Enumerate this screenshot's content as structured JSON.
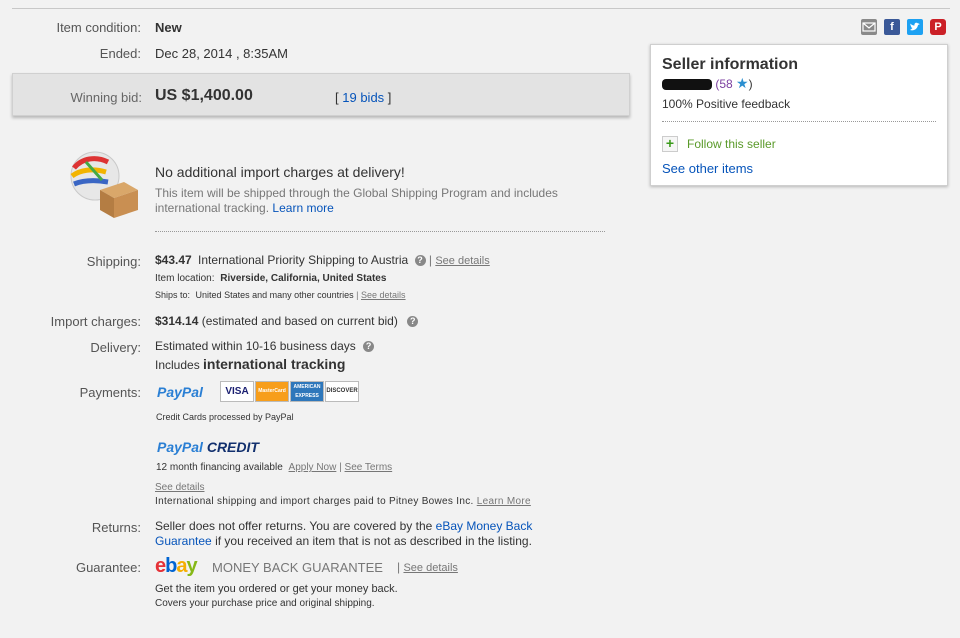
{
  "item_condition": {
    "label": "Item condition:",
    "value": "New"
  },
  "ended": {
    "label": "Ended:",
    "value": "Dec 28, 2014 , 8:35AM"
  },
  "winning_bid": {
    "label": "Winning bid:",
    "value": "US $1,400.00",
    "bids_link": "19 bids",
    "bracket_open": "[",
    "bracket_close": "]"
  },
  "import_notice": {
    "title": "No additional import charges at delivery!",
    "text": "This item will be shipped through the Global Shipping Program and includes international tracking.",
    "learn_more": "Learn more"
  },
  "shipping": {
    "label": "Shipping:",
    "price": "$43.47",
    "service": "International Priority Shipping to Austria",
    "see_details": "See details",
    "location_label": "Item location:",
    "location_value": "Riverside, California, United States",
    "ships_to_label": "Ships to:",
    "ships_to_value": "United States and many other countries",
    "ships_see_details": "See details"
  },
  "import_charges": {
    "label": "Import charges:",
    "price": "$314.14",
    "note": "(estimated and based on current bid)"
  },
  "delivery": {
    "label": "Delivery:",
    "line1": "Estimated within 10-16 business days",
    "line2_prefix": "Includes",
    "line2_bold": "international tracking"
  },
  "payments": {
    "label": "Payments:",
    "paypal_logo": "PayPal",
    "cards": [
      "VISA",
      "MasterCard",
      "AMERICAN EXPRESS",
      "DISCOVER"
    ],
    "cards_note": "Credit Cards processed by PayPal",
    "credit_logo_pay": "PayPal",
    "credit_logo_credit": "CREDIT",
    "financing": "12 month financing available",
    "apply_now": "Apply Now",
    "see_terms": "See Terms",
    "see_details": "See details",
    "pitney_note": "International shipping and import charges paid to Pitney Bowes Inc.",
    "pitney_learn_more": "Learn More"
  },
  "returns": {
    "label": "Returns:",
    "text_before": "Seller does not offer returns. You are covered by the",
    "link": "eBay Money Back Guarantee",
    "text_after": "if you received an item that is not as described in the listing."
  },
  "guarantee": {
    "label": "Guarantee:",
    "ebay_e": "e",
    "ebay_b": "b",
    "ebay_a": "a",
    "ebay_y": "y",
    "title": "MONEY BACK GUARANTEE",
    "see_details": "See details",
    "line1": "Get the item you ordered or get your money back.",
    "line2": "Covers your purchase price and original shipping."
  },
  "seller_info": {
    "title": "Seller information",
    "feedback_count": "(58",
    "feedback_close": ")",
    "positive": "100% Positive feedback",
    "follow": "Follow this seller",
    "other_items": "See other items"
  },
  "colors": {
    "link": "#0654ba",
    "follow_green": "#5a9a2a",
    "star": "#2b8fd0"
  },
  "icons": [
    "envelope-icon",
    "facebook-icon",
    "twitter-icon",
    "pinterest-icon",
    "globe-box-icon",
    "question-icon",
    "star-icon",
    "plus-icon"
  ]
}
